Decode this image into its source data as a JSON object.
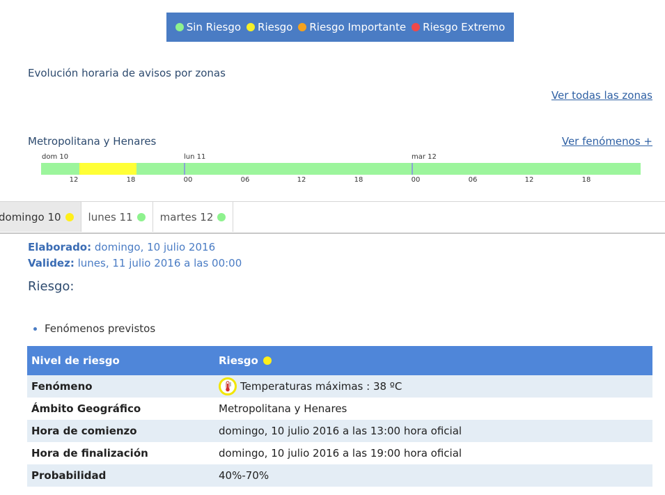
{
  "legend": [
    {
      "label": "Sin Riesgo",
      "color": "#8ef28e"
    },
    {
      "label": "Riesgo",
      "color": "#f5ef2a"
    },
    {
      "label": "Riesgo Importante",
      "color": "#f5a21e"
    },
    {
      "label": "Riesgo Extremo",
      "color": "#f04848"
    }
  ],
  "section_title": "Evolución horaria de avisos por zonas",
  "link_all_zones": "Ver todas las zonas",
  "zone": {
    "name": "Metropolitana y Henares",
    "link_phenomena": "Ver fenómenos +"
  },
  "timeline": {
    "days": [
      "dom 10",
      "lun 11",
      "mar 12"
    ],
    "hours": [
      "12",
      "18",
      "00",
      "06",
      "12",
      "18",
      "00",
      "06",
      "12",
      "18"
    ],
    "segments": [
      {
        "level": "Sin Riesgo",
        "color": "#9cf59c"
      },
      {
        "level": "Riesgo",
        "color": "#ffff36"
      },
      {
        "level": "Sin Riesgo",
        "color": "#9cf59c"
      }
    ]
  },
  "tabs": [
    {
      "label": "domingo 10",
      "color": "#ffef1a"
    },
    {
      "label": "lunes 11",
      "color": "#8ef28e"
    },
    {
      "label": "martes 12",
      "color": "#8ef28e"
    }
  ],
  "meta": {
    "elaborado_label": "Elaborado:",
    "elaborado_value": "domingo, 10 julio 2016",
    "validez_label": "Validez:",
    "validez_value": "lunes, 11 julio 2016 a las 00:00"
  },
  "riesgo_heading": "Riesgo:",
  "bullet_text": "Fenómenos previstos",
  "table": {
    "head_key": "Nivel de riesgo",
    "head_value": "Riesgo",
    "head_color": "#ffef1a",
    "rows": [
      {
        "key": "Fenómeno",
        "value": "Temperaturas máximas : 38 ºC",
        "icon": "thermometer-icon"
      },
      {
        "key": "Ámbito Geográfico",
        "value": "Metropolitana y Henares"
      },
      {
        "key": "Hora de comienzo",
        "value": "domingo, 10 julio 2016 a las 13:00 hora oficial"
      },
      {
        "key": "Hora de finalización",
        "value": "domingo, 10 julio 2016 a las 19:00 hora oficial"
      },
      {
        "key": "Probabilidad",
        "value": "40%-70%"
      }
    ]
  }
}
